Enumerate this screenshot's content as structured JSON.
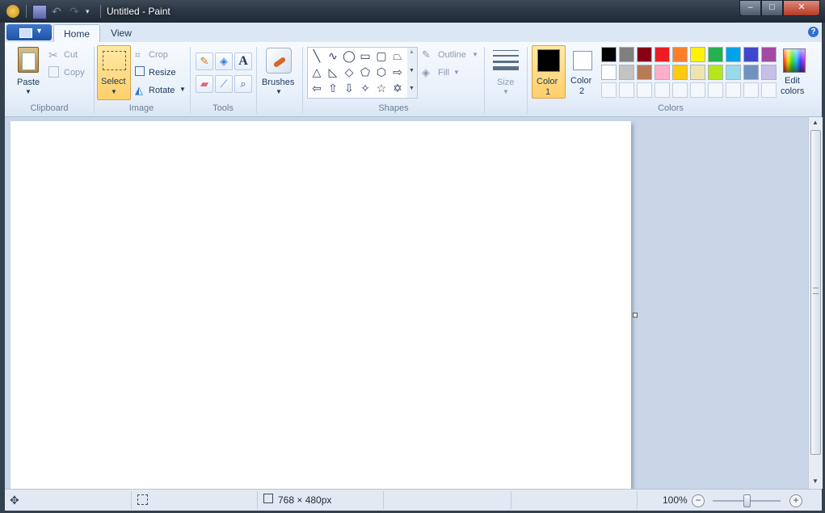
{
  "window": {
    "title": "Untitled - Paint",
    "minimize": "–",
    "maximize": "□",
    "close": "✕"
  },
  "tabs": {
    "home": "Home",
    "view": "View",
    "help": "?"
  },
  "clipboard": {
    "paste": "Paste",
    "cut": "Cut",
    "copy": "Copy",
    "group": "Clipboard"
  },
  "image": {
    "select": "Select",
    "crop": "Crop",
    "resize": "Resize",
    "rotate": "Rotate",
    "group": "Image"
  },
  "tools": {
    "group": "Tools"
  },
  "brushes": {
    "label": "Brushes"
  },
  "shapes": {
    "outline": "Outline",
    "fill": "Fill",
    "group": "Shapes"
  },
  "size": {
    "label": "Size"
  },
  "colors": {
    "color1_line1": "Color",
    "color1_line2": "1",
    "color2_line1": "Color",
    "color2_line2": "2",
    "edit_line1": "Edit",
    "edit_line2": "colors",
    "group": "Colors",
    "color1_value": "#000000",
    "color2_value": "#ffffff",
    "palette_row1": [
      "#000000",
      "#7f7f7f",
      "#880015",
      "#ed1c24",
      "#ff7f27",
      "#fff200",
      "#22b14c",
      "#00a2e8",
      "#3f48cc",
      "#a349a4"
    ],
    "palette_row2": [
      "#ffffff",
      "#c3c3c3",
      "#b97a57",
      "#ffaec9",
      "#ffc90e",
      "#efe4b0",
      "#b5e61d",
      "#99d9ea",
      "#7092be",
      "#c8bfe7"
    ]
  },
  "status": {
    "dimensions": "768 × 480px",
    "zoom": "100%"
  }
}
